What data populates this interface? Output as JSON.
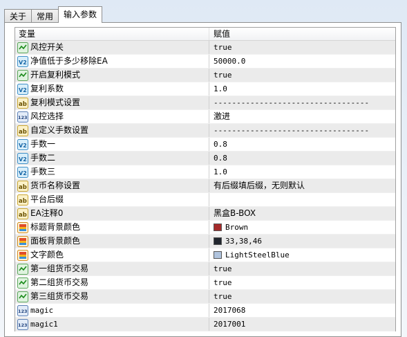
{
  "tabs": [
    {
      "label": "关于"
    },
    {
      "label": "常用"
    },
    {
      "label": "输入参数"
    }
  ],
  "header": {
    "variable": "变量",
    "value": "赋值"
  },
  "rows": [
    {
      "icon": "bool-icon",
      "name": "风控开关",
      "value": "true"
    },
    {
      "icon": "double-icon",
      "name": "净值低于多少移除EA",
      "value": "50000.0"
    },
    {
      "icon": "bool-icon",
      "name": "开启复利模式",
      "value": "true"
    },
    {
      "icon": "double-icon",
      "name": "复利系数",
      "value": "1.0"
    },
    {
      "icon": "string-icon",
      "name": "复利模式设置",
      "value": "----------------------------------"
    },
    {
      "icon": "int-icon",
      "name": "风控选择",
      "value": "激进"
    },
    {
      "icon": "string-icon",
      "name": "自定义手数设置",
      "value": "----------------------------------"
    },
    {
      "icon": "double-icon",
      "name": "手数一",
      "value": "0.8"
    },
    {
      "icon": "double-icon",
      "name": "手数二",
      "value": "0.8"
    },
    {
      "icon": "double-icon",
      "name": "手数三",
      "value": "1.0"
    },
    {
      "icon": "string-icon",
      "name": "货币名称设置",
      "value": "有后缀填后缀，无则默认"
    },
    {
      "icon": "string-icon",
      "name": "平台后缀",
      "value": ""
    },
    {
      "icon": "string-icon",
      "name": "EA注释0",
      "value": "黑盒B-BOX"
    },
    {
      "icon": "color-icon",
      "name": "标题背景颜色",
      "value": "Brown",
      "swatch": "#a52a2a"
    },
    {
      "icon": "color-icon",
      "name": "面板背景颜色",
      "value": "33,38,46",
      "swatch": "#21262e"
    },
    {
      "icon": "color-icon",
      "name": "文字颜色",
      "value": "LightSteelBlue",
      "swatch": "#b0c4de"
    },
    {
      "icon": "bool-icon",
      "name": "第一组货币交易",
      "value": "true"
    },
    {
      "icon": "bool-icon",
      "name": "第二组货币交易",
      "value": "true"
    },
    {
      "icon": "bool-icon",
      "name": "第三组货币交易",
      "value": "true"
    },
    {
      "icon": "int-icon",
      "name": "magic",
      "value": "2017068"
    },
    {
      "icon": "int-icon",
      "name": "magic1",
      "value": "2017001"
    }
  ]
}
